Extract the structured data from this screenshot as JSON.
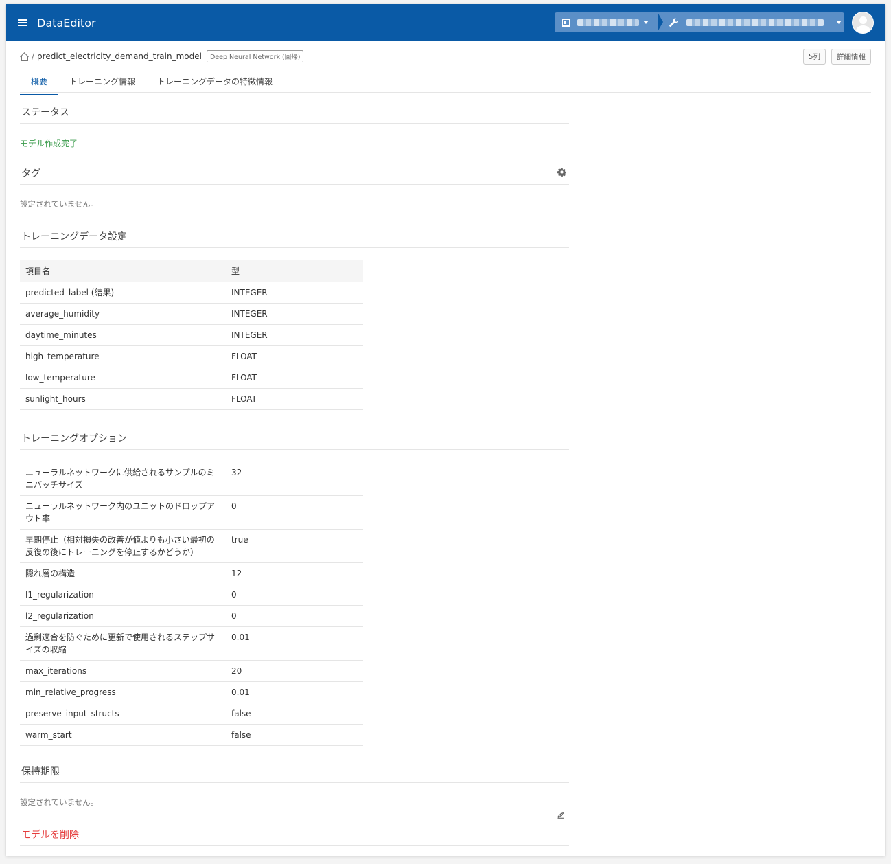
{
  "app": {
    "title": "DataEditor"
  },
  "context": {
    "org_icon": "building-icon",
    "project_icon": "wrench-icon"
  },
  "breadcrumb": {
    "separator": "/",
    "model_name": "predict_electricity_demand_train_model",
    "model_type": "Deep Neural Network (回帰)"
  },
  "header_buttons": {
    "columns": "5列",
    "details": "詳細情報"
  },
  "tabs": [
    {
      "label": "概要",
      "active": true
    },
    {
      "label": "トレーニング情報",
      "active": false
    },
    {
      "label": "トレーニングデータの特徴情報",
      "active": false
    }
  ],
  "status": {
    "title": "ステータス",
    "value": "モデル作成完了",
    "color": "#3a9b4b"
  },
  "tags": {
    "title": "タグ",
    "empty": "設定されていません。"
  },
  "training_data": {
    "title": "トレーニングデータ設定",
    "headers": [
      "項目名",
      "型"
    ],
    "rows": [
      [
        "predicted_label (結果)",
        "INTEGER"
      ],
      [
        "average_humidity",
        "INTEGER"
      ],
      [
        "daytime_minutes",
        "INTEGER"
      ],
      [
        "high_temperature",
        "FLOAT"
      ],
      [
        "low_temperature",
        "FLOAT"
      ],
      [
        "sunlight_hours",
        "FLOAT"
      ]
    ]
  },
  "training_options": {
    "title": "トレーニングオプション",
    "rows": [
      [
        "ニューラルネットワークに供給されるサンプルのミニバッチサイズ",
        "32"
      ],
      [
        "ニューラルネットワーク内のユニットのドロップアウト率",
        "0"
      ],
      [
        "早期停止（相対損失の改善が値よりも小さい最初の反復の後にトレーニングを停止するかどうか）",
        "true"
      ],
      [
        "隠れ層の構造",
        "12"
      ],
      [
        "l1_regularization",
        "0"
      ],
      [
        "l2_regularization",
        "0"
      ],
      [
        "過剰適合を防ぐために更新で使用されるステップサイズの収縮",
        "0.01"
      ],
      [
        "max_iterations",
        "20"
      ],
      [
        "min_relative_progress",
        "0.01"
      ],
      [
        "preserve_input_structs",
        "false"
      ],
      [
        "warm_start",
        "false"
      ]
    ]
  },
  "retention": {
    "title": "保持期限",
    "empty": "設定されていません。"
  },
  "delete_model": {
    "title": "モデルを削除",
    "button": "削除",
    "color": "#ef6a6a"
  },
  "colors": {
    "topbar": "#0a5aa6",
    "accent": "#0a5aa6",
    "danger": "#e53d3d"
  }
}
